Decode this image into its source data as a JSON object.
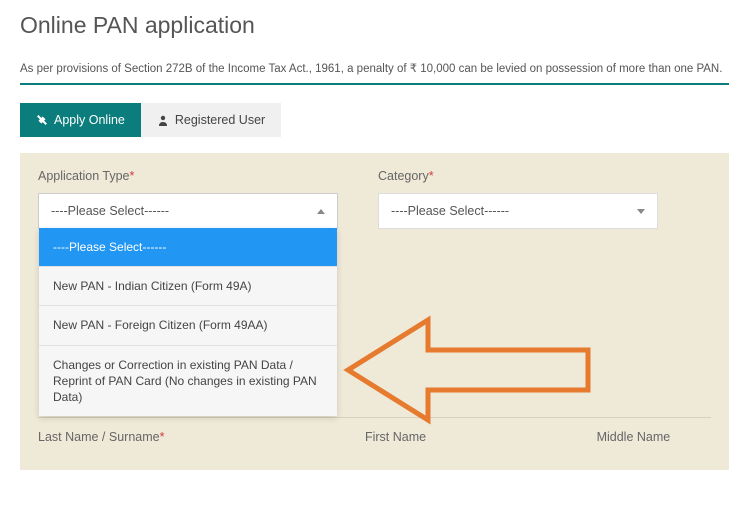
{
  "page": {
    "title": "Online PAN application",
    "notice": "As per provisions of Section 272B of the Income Tax Act., 1961, a penalty of ₹ 10,000 can be levied on possession of more than one PAN."
  },
  "tabs": {
    "apply_online": "Apply Online",
    "registered_user": "Registered User"
  },
  "form": {
    "application_type": {
      "label": "Application Type",
      "placeholder": "----Please Select------",
      "options": {
        "opt0": "----Please Select------",
        "opt1": "New PAN - Indian Citizen (Form 49A)",
        "opt2": "New PAN - Foreign Citizen (Form 49AA)",
        "opt3": "Changes or Correction in existing PAN Data / Reprint of PAN Card (No changes in existing PAN Data)"
      }
    },
    "category": {
      "label": "Category",
      "placeholder": "----Please Select------"
    },
    "last_name": {
      "label": "Last Name / Surname"
    },
    "first_name": {
      "label": "First Name"
    },
    "middle_name": {
      "label": "Middle Name"
    }
  },
  "colors": {
    "teal": "#0a7d7c",
    "arrow": "#e67a2e"
  }
}
